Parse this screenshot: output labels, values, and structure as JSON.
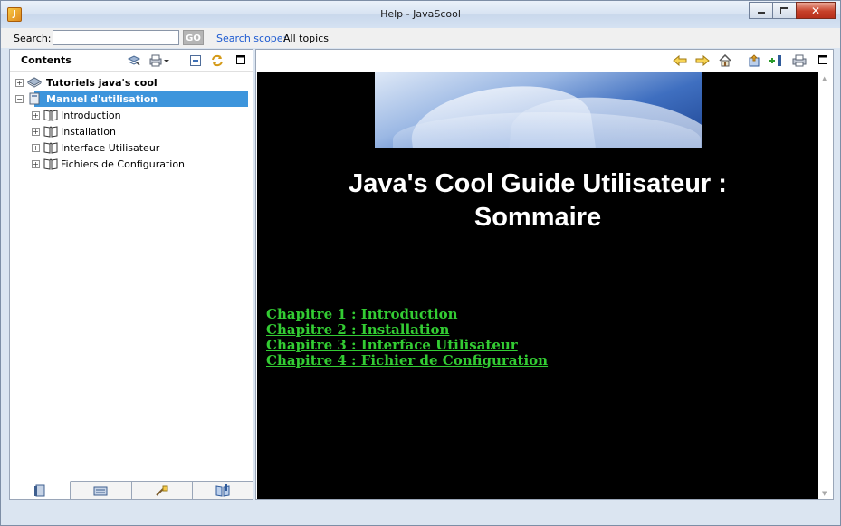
{
  "window": {
    "title": "Help - JavaScool",
    "app_icon": "javascool-icon",
    "controls": {
      "minimize": "minimize-icon",
      "maximize": "maximize-icon",
      "close": "close-icon"
    }
  },
  "search": {
    "label": "Search:",
    "value": "",
    "go_label": "GO",
    "scope_link": "Search scope:",
    "scope_value": "All topics"
  },
  "left_panel": {
    "title": "Contents",
    "toolbar_icons": [
      "link-with-contents-icon",
      "print-dropdown-icon",
      "collapse-all-icon",
      "sync-icon",
      "maximize-view-icon"
    ],
    "tree": [
      {
        "label": "Tutoriels java's cool",
        "expander": "+",
        "icon": "book-stack-icon",
        "bold": true,
        "selected": false
      },
      {
        "label": "Manuel d'utilisation",
        "expander": "−",
        "icon": "book-stack-icon",
        "bold": true,
        "selected": true,
        "children": [
          {
            "label": "Introduction",
            "expander": "+",
            "icon": "open-book-icon"
          },
          {
            "label": "Installation",
            "expander": "+",
            "icon": "open-book-icon"
          },
          {
            "label": "Interface Utilisateur",
            "expander": "+",
            "icon": "open-book-icon"
          },
          {
            "label": "Fichiers de Configuration",
            "expander": "+",
            "icon": "open-book-icon"
          }
        ]
      }
    ],
    "bottom_tabs": [
      "contents-tab-icon",
      "index-tab-icon",
      "search-tab-icon",
      "bookmarks-tab-icon"
    ]
  },
  "right_panel": {
    "toolbar_icons": [
      "back-arrow-icon",
      "forward-arrow-icon",
      "home-icon",
      "show-in-contents-icon",
      "bookmark-add-icon",
      "print-icon",
      "maximize-view-icon"
    ],
    "document": {
      "banner_image": "open-book-banner",
      "title_line1": "Java's Cool Guide Utilisateur :",
      "title_line2": "Sommaire",
      "chapters": [
        "Chapitre 1 : Introduction",
        "Chapitre 2 : Installation",
        "Chapitre 3 : Interface Utilisateur",
        "Chapitre 4 : Fichier de Configuration"
      ]
    }
  },
  "colors": {
    "content_background": "#000000",
    "title_text": "#ffffff",
    "chapter_link": "#33cc33",
    "selection": "#3d95dc",
    "link": "#1e5bd1"
  }
}
